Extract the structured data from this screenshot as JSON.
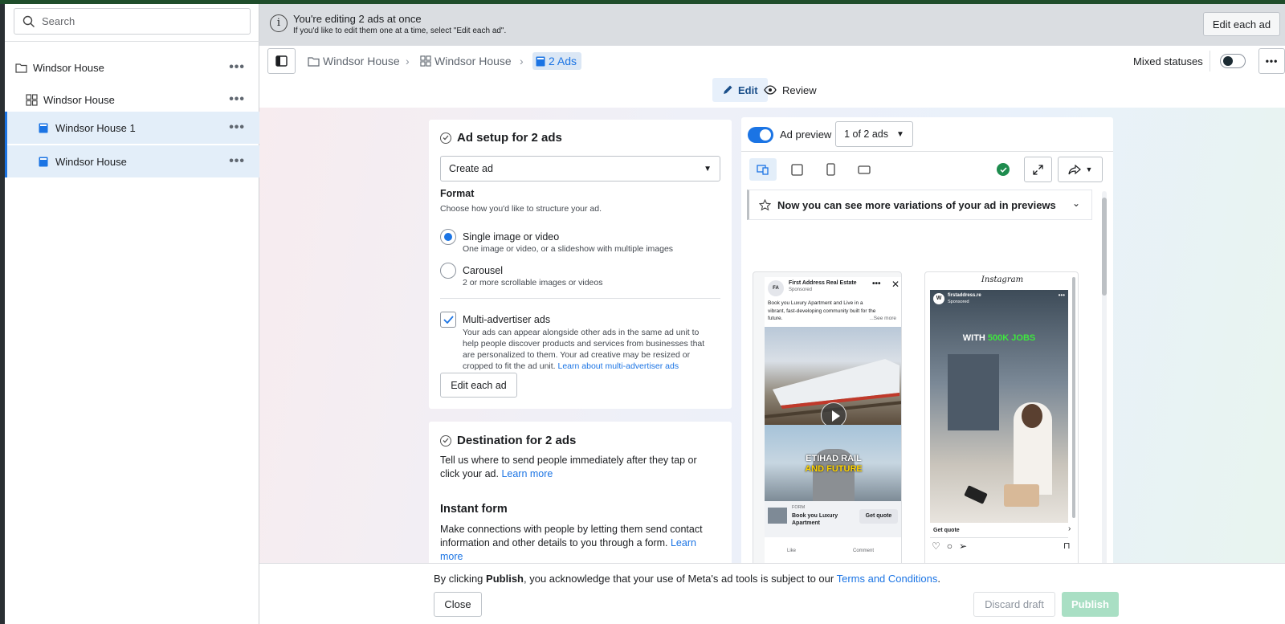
{
  "sidebar": {
    "search_placeholder": "Search",
    "items": [
      {
        "label": "Windsor House",
        "icon": "folder-icon"
      },
      {
        "label": "Windsor House",
        "icon": "adset-grid-icon"
      },
      {
        "label": "Windsor House 1",
        "icon": "ad-icon"
      },
      {
        "label": "Windsor House",
        "icon": "ad-icon"
      }
    ]
  },
  "banner": {
    "title": "You're editing 2 ads at once",
    "subtitle": "If you'd like to edit them one at a time, select \"Edit each ad\".",
    "button": "Edit each ad"
  },
  "breadcrumb": {
    "campaign": "Windsor House",
    "adset": "Windsor House",
    "ads": "2 Ads",
    "status": "Mixed statuses"
  },
  "modes": {
    "edit": "Edit",
    "review": "Review"
  },
  "ad_setup": {
    "title": "Ad setup for 2 ads",
    "select_value": "Create ad",
    "format_label": "Format",
    "format_help": "Choose how you'd like to structure your ad.",
    "option1_title": "Single image or video",
    "option1_desc": "One image or video, or a slideshow with multiple images",
    "option2_title": "Carousel",
    "option2_desc": "2 or more scrollable images or videos",
    "multi_title": "Multi-advertiser ads",
    "multi_desc_1": "Your ads can appear alongside other ads in the same ad unit to",
    "multi_desc_2": "help people discover products and services from businesses that",
    "multi_desc_3": "are personalized to them. Your ad creative may be resized or",
    "multi_desc_4": "cropped to fit the ad unit.",
    "multi_link": "Learn about multi-advertiser ads",
    "edit_button": "Edit each ad"
  },
  "destination": {
    "title": "Destination for 2 ads",
    "desc_1": "Tell us where to send people immediately after they tap or",
    "desc_2": "click your ad.",
    "desc_link": "Learn more",
    "instant_title": "Instant form",
    "instant_1": "Make connections with people by letting them send contact",
    "instant_2": "information and other details to you through a form.",
    "instant_link_a": "Learn",
    "instant_link_b": "more"
  },
  "preview": {
    "label": "Ad preview",
    "count": "1 of 2 ads",
    "notice": "Now you can see more variations of your ad in previews",
    "fb": {
      "page": "First Address Real Estate",
      "sponsored": "Sponsored",
      "body_1": "Book you Luxury Apartment and Live in a",
      "body_2": "vibrant, fast-developing community built for the",
      "body_3": "future.",
      "see_more": "...See more",
      "overlay_1": "ETIHAD RAIL",
      "overlay_2": "AND FUTURE",
      "form_label": "FORM",
      "headline_1": "Book you Luxury",
      "headline_2": "Apartment",
      "cta": "Get quote",
      "like": "Like",
      "comment": "Comment"
    },
    "ig": {
      "brand": "Instagram",
      "account": "firstaddress.re",
      "sponsored": "Sponsored",
      "overlay_pre": "WITH",
      "overlay_hl_1": "500K",
      "overlay_hl_2": "JOBS",
      "cta": "Get quote"
    }
  },
  "footer": {
    "legal_pre": "By clicking",
    "legal_bold": "Publish",
    "legal_mid": ", you acknowledge that your use of Meta's ad tools is subject to our",
    "legal_link": "Terms and Conditions",
    "legal_end": ".",
    "close": "Close",
    "discard": "Discard draft",
    "publish": "Publish"
  },
  "colors": {
    "accent": "#1b74e4",
    "publish_disabled": "#a9dfc4",
    "selection": "#e3eef9"
  }
}
